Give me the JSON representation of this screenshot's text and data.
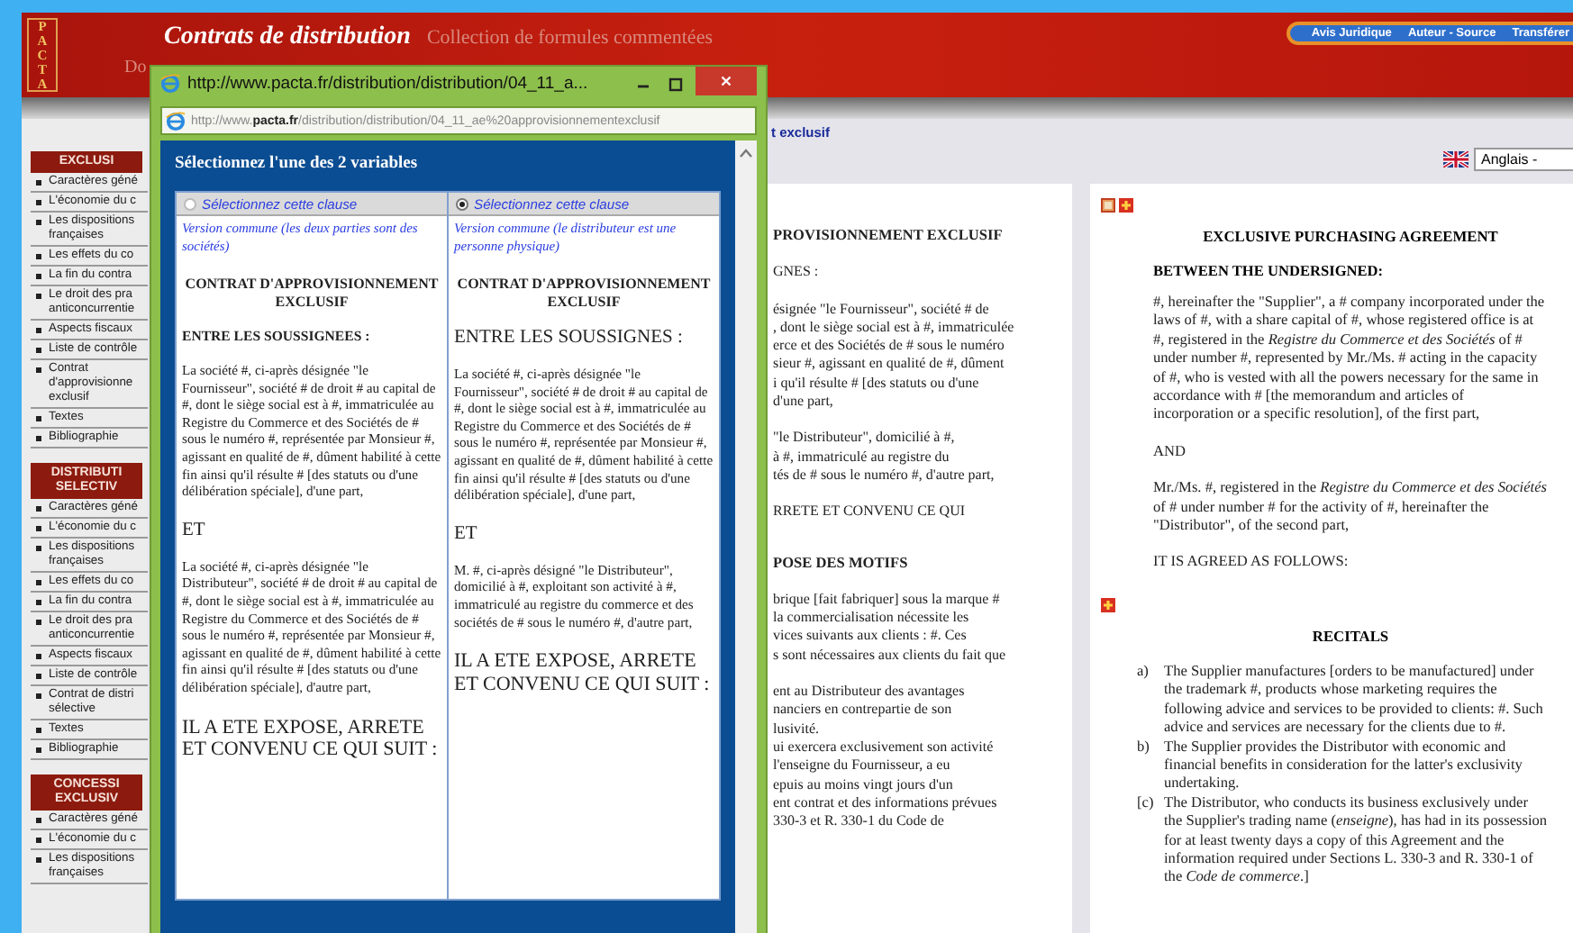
{
  "header": {
    "logo": "PACTA",
    "title": "Contrats de distribution",
    "subtitle": "Collection de formules commentées",
    "fragment": "Do",
    "nav": [
      "Avis Juridique",
      "Auteur - Source",
      "Transférer"
    ]
  },
  "breadcrumb": "t exclusif",
  "language": {
    "value": "Anglais -"
  },
  "sidebar": {
    "sections": [
      {
        "title": "EXCLUSI",
        "items": [
          "Caractères géné",
          "L'économie du c",
          "Les dispositions françaises",
          "Les effets du co",
          "La fin du contra",
          "Le droit des pra anticoncurrentie",
          "Aspects fiscaux",
          "Liste de contrôle",
          "Contrat d'approvisionne exclusif",
          "Textes",
          "Bibliographie"
        ]
      },
      {
        "title": "DISTRIBUTI SELECTIV",
        "items": [
          "Caractères géné",
          "L'économie du c",
          "Les dispositions françaises",
          "Les effets du co",
          "La fin du contra",
          "Le droit des pra anticoncurrentie",
          "Aspects fiscaux",
          "Liste de contrôle",
          "Contrat de distri sélective",
          "Textes",
          "Bibliographie"
        ]
      },
      {
        "title": "CONCESSI EXCLUSIV",
        "items": [
          "Caractères géné",
          "L'économie du c",
          "Les dispositions françaises"
        ]
      }
    ]
  },
  "popup": {
    "title": "http://www.pacta.fr/distribution/distribution/04_11_a...",
    "address": "http://www.**pacta.fr**/distribution/distribution/04_11_ae%20approvisionnementexclusif",
    "heading": "Sélectionnez l'une des 2 variables",
    "variants": [
      {
        "selected": false,
        "label": "Sélectionnez cette clause",
        "blocks": [
          {
            "kind": "note",
            "text": "Version commune (les deux parties sont des sociétés)"
          },
          {
            "kind": "title",
            "text": "CONTRAT D'APPROVISIONNEMENT EXCLUSIF"
          },
          {
            "kind": "heading_bold",
            "text": "ENTRE LES SOUSSIGNEES :"
          },
          {
            "kind": "para",
            "text": "La société #, ci-après désignée \"le Fournisseur\", société # de droit # au capital de #, dont le siège social est à #, immatriculée au Registre du Commerce et des Sociétés de # sous le numéro #, représentée par Monsieur #, agissant en qualité de #, dûment habilité à cette fin ainsi qu'il résulte # [des statuts ou d'une délibération spéciale], d'une part,"
          },
          {
            "kind": "heading_large",
            "text": "ET"
          },
          {
            "kind": "para",
            "text": "La société #, ci-après désignée \"le Distributeur\", société # de droit # au capital de #, dont le siège social est à #, immatriculée au Registre du Commerce et des Sociétés de # sous le numéro #, représentée par Monsieur #, agissant en qualité de #, dûment habilité à cette fin ainsi qu'il résulte # [des statuts ou d'une délibération spéciale], d'autre part,"
          },
          {
            "kind": "closing",
            "text": "IL A ETE EXPOSE, ARRETE ET CONVENU CE QUI SUIT :"
          }
        ]
      },
      {
        "selected": true,
        "label": "Sélectionnez cette clause",
        "blocks": [
          {
            "kind": "note",
            "text": "Version commune (le distributeur est une personne physique)"
          },
          {
            "kind": "title",
            "text": "CONTRAT D'APPROVISIONNEMENT EXCLUSIF"
          },
          {
            "kind": "heading_large",
            "text": "ENTRE LES SOUSSIGNES :"
          },
          {
            "kind": "para",
            "text": "La société #, ci-après désignée \"le Fournisseur\", société # de droit # au capital de #, dont le siège social est à #, immatriculée au Registre du Commerce et des Sociétés de # sous le numéro #, représentée par Monsieur #, agissant en qualité de #, dûment habilité à cette fin ainsi qu'il résulte # [des statuts ou d'une délibération spéciale], d'une part,"
          },
          {
            "kind": "heading_large",
            "text": "ET"
          },
          {
            "kind": "para",
            "text": "M. #, ci-après désigné \"le Distributeur\", domicilié à #, exploitant son activité à #, immatriculé au registre du commerce et des sociétés de # sous le numéro #, d'autre part,"
          },
          {
            "kind": "closing",
            "text": "IL A ETE EXPOSE, ARRETE ET CONVENU CE QUI SUIT :"
          }
        ]
      }
    ]
  },
  "middle_document": {
    "blocks": [
      {
        "kind": "heading",
        "lines": [
          "PROVISIONNEMENT EXCLUSIF"
        ]
      },
      {
        "kind": "text",
        "lines": [
          "GNES :"
        ]
      },
      {
        "kind": "text",
        "lines": [
          "ésignée \"le Fournisseur\", société # de",
          ", dont le siège social est à #, immatriculée",
          "erce et des Sociétés de # sous le numéro",
          "sieur #, agissant en qualité de #, dûment",
          "i qu'il résulte # [des statuts ou d'une",
          "d'une part,"
        ]
      },
      {
        "kind": "text",
        "lines": [
          "\"le Distributeur\", domicilié à #,",
          "à #, immatriculé au registre du",
          "tés de # sous le numéro #, d'autre part,"
        ]
      },
      {
        "kind": "text",
        "lines": [
          "RRETE ET CONVENU CE QUI"
        ]
      },
      {
        "kind": "heading",
        "lines": [
          "POSE DES MOTIFS"
        ]
      },
      {
        "kind": "text",
        "lines": [
          "brique [fait fabriquer] sous la marque #",
          "la commercialisation nécessite les",
          "vices suivants aux clients : #. Ces",
          "s sont nécessaires aux clients du fait que"
        ]
      },
      {
        "kind": "text",
        "lines": [
          "ent au Distributeur des avantages",
          "nanciers en contrepartie de son",
          "lusivité.",
          "ui exercera exclusivement son activité",
          "l'enseigne du Fournisseur, a eu",
          "epuis au moins vingt jours d'un",
          "ent contrat et des informations prévues",
          "330-3 et R. 330-1 du Code de"
        ]
      }
    ]
  },
  "english_document": {
    "sections": [
      {
        "has_copy": true,
        "blocks": [
          {
            "kind": "title",
            "text": "EXCLUSIVE PURCHASING AGREEMENT"
          },
          {
            "kind": "heading",
            "text": "BETWEEN THE UNDERSIGNED:"
          },
          {
            "kind": "para",
            "text": "#, hereinafter the \"Supplier\", a # company incorporated under the laws of #, with a share capital of #, whose registered office is at #, registered in the *Registre du Commerce et des Sociétés* of # under number #, represented by Mr./Ms. # acting in the capacity of #, who is vested with all the powers necessary for the same in accordance with # [the memorandum and articles of incorporation or a specific resolution], of the first part,"
          },
          {
            "kind": "para",
            "text": "AND"
          },
          {
            "kind": "para",
            "text": "Mr./Ms. #, registered in the *Registre du Commerce et des Sociétés* of # under number # for the activity of #, hereinafter the \"Distributor\", of the second part,"
          },
          {
            "kind": "para",
            "text": "IT IS AGREED AS FOLLOWS:"
          }
        ]
      },
      {
        "has_copy": false,
        "blocks": [
          {
            "kind": "title",
            "text": "RECITALS"
          },
          {
            "kind": "list",
            "items": [
              {
                "marker": "a)",
                "text": "The Supplier manufactures [orders to be manufactured] under the trademark #, products whose marketing requires the following advice and services to be provided to clients: #. Such advice and services are necessary for the clients due to #."
              },
              {
                "marker": "b)",
                "text": "The Supplier provides the Distributor with economic and financial benefits in consideration for the latter's exclusivity undertaking."
              },
              {
                "marker": "[c)",
                "text": "The Distributor, who conducts its business exclusively under the Supplier's trading name (*enseigne*), has had in its possession for at least twenty days a copy of this Agreement and the information required under Sections L. 330-3 and R. 330-1 of the *Code de commerce*.]"
              }
            ]
          }
        ]
      }
    ]
  }
}
